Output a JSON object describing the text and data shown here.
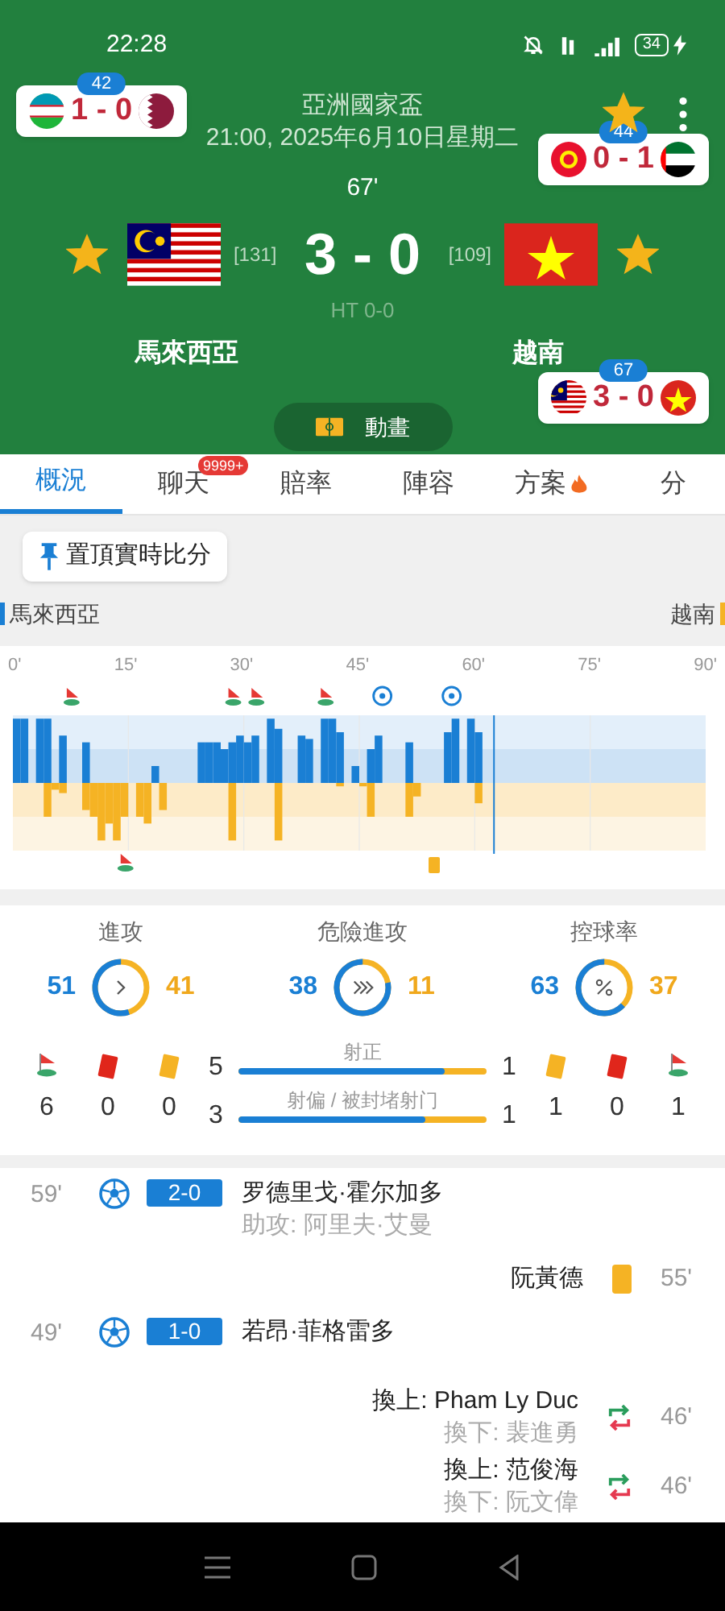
{
  "status_bar": {
    "time": "22:28",
    "battery": "34"
  },
  "header": {
    "competition": "亞洲國家盃",
    "datetime": "21:00, 2025年6月10日星期二",
    "minute": "67'",
    "score": "3 - 0",
    "halftime": "HT 0-0",
    "animation_button": "動畫",
    "match_favorite": true,
    "home": {
      "name": "馬來西亞",
      "rank": "[131]",
      "favorite": true
    },
    "away": {
      "name": "越南",
      "rank": "[109]",
      "favorite": true
    }
  },
  "other_matches": [
    {
      "minute": "42",
      "score": "1 - 0"
    },
    {
      "minute": "44",
      "score": "0 - 1"
    },
    {
      "minute": "67",
      "score": "3 - 0"
    }
  ],
  "tabs": [
    {
      "label": "概況",
      "selected": true
    },
    {
      "label": "聊天",
      "selected": false,
      "badge": "9999+"
    },
    {
      "label": "賠率",
      "selected": false
    },
    {
      "label": "陣容",
      "selected": false
    },
    {
      "label": "方案",
      "selected": false,
      "hot": true
    },
    {
      "label": "分",
      "selected": false
    }
  ],
  "pin_button": "置頂實時比分",
  "legend": {
    "home": "馬來西亞",
    "away": "越南"
  },
  "timeline_ticks": [
    "0'",
    "15'",
    "30'",
    "45'",
    "60'",
    "75'",
    "90'"
  ],
  "stats": [
    {
      "kind": "attack",
      "label": "進攻",
      "home": "51",
      "away": "41",
      "level": 0.55
    },
    {
      "kind": "danger",
      "label": "危險進攻",
      "home": "38",
      "away": "11",
      "level": 0.78
    },
    {
      "kind": "possession",
      "label": "控球率",
      "home": "63",
      "away": "37",
      "level": 0.63
    }
  ],
  "counts": {
    "home": [
      {
        "kind": "corner",
        "value": "6"
      },
      {
        "kind": "red",
        "value": "0"
      },
      {
        "kind": "yellow",
        "value": "0"
      }
    ],
    "away": [
      {
        "kind": "yellow",
        "value": "1"
      },
      {
        "kind": "red",
        "value": "0"
      },
      {
        "kind": "corner",
        "value": "1"
      }
    ]
  },
  "shots": [
    {
      "label": "射正",
      "home": "5",
      "away": "1",
      "level": 0.83
    },
    {
      "label": "射偏 / 被封堵射门",
      "home": "3",
      "away": "1",
      "level": 0.75
    }
  ],
  "events": [
    {
      "kind": "goal",
      "minute": "59'",
      "score": "2-0",
      "player": "罗德里戈·霍尔加多",
      "assist": "助攻: 阿里夫·艾曼"
    },
    {
      "kind": "yellow",
      "minute": "55'",
      "player": "阮黃德"
    },
    {
      "kind": "goal",
      "minute": "49'",
      "score": "1-0",
      "player": "若昂·菲格雷多"
    },
    {
      "kind": "sub",
      "minute": "46'",
      "player": "換上: Pham Ly Duc",
      "out": "換下: 裴進勇"
    },
    {
      "kind": "sub",
      "minute": "46'",
      "player": "換上: 范俊海",
      "out": "換下: 阮文偉"
    }
  ]
}
